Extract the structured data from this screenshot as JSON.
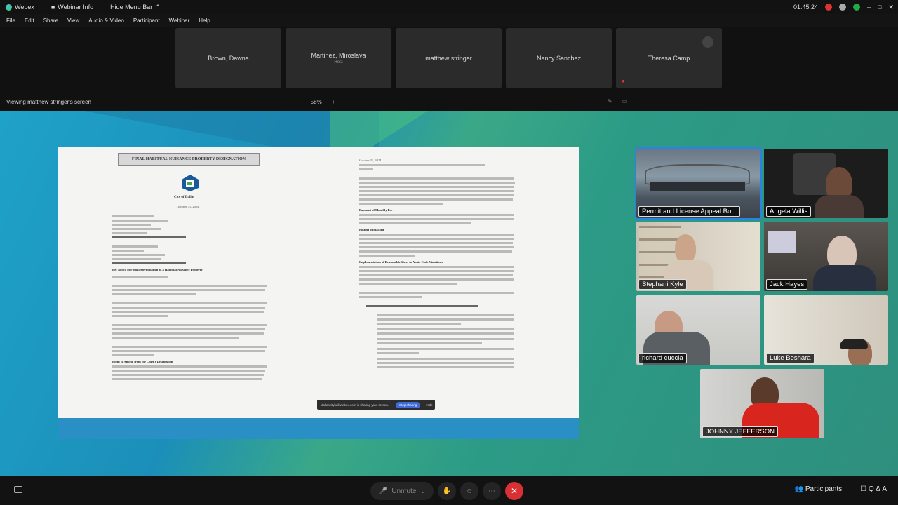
{
  "titlebar": {
    "app_name": "Webex",
    "info": "Webinar Info",
    "hide_menu": "Hide Menu Bar",
    "time": "01:45:24"
  },
  "menu": [
    "File",
    "Edit",
    "Share",
    "View",
    "Audio & Video",
    "Participant",
    "Webinar",
    "Help"
  ],
  "panelists": [
    {
      "name": "Brown, Dawna",
      "sub": ""
    },
    {
      "name": "Martinez, Miroslava",
      "sub": "Host"
    },
    {
      "name": "matthew stringer",
      "sub": ""
    },
    {
      "name": "Nancy Sanchez",
      "sub": ""
    },
    {
      "name": "Theresa Camp",
      "sub": ""
    }
  ],
  "viewing": {
    "label": "Viewing matthew stringer's screen",
    "zoom": "58%",
    "zoom_out": "−",
    "zoom_in": "+"
  },
  "document": {
    "banner": "FINAL HABITUAL NUISANCE PROPERTY DESIGNATION",
    "city": "City of Dallas",
    "date": "October 31, 2024",
    "re_line": "Re: Notice of Final Determination as a Habitual Nuisance Property",
    "right_date": "October 31, 2024",
    "heading_fee": "Payment of Monthly Fee",
    "heading_placard": "Posting of Placard",
    "heading_steps": "Implementation of Reasonable Steps to Abate Code Violations",
    "heading_appeal": "Right to Appeal from the Chief's Designation"
  },
  "sharebar": {
    "text": "dallascityhall.webex.com is sharing your screen.",
    "stop": "Stop sharing",
    "hide": "Hide"
  },
  "videos": [
    {
      "name": "Permit and License Appeal Bo..."
    },
    {
      "name": "Angela Willis"
    },
    {
      "name": "Stephani Kyle"
    },
    {
      "name": "Jack Hayes"
    },
    {
      "name": "richard cuccia"
    },
    {
      "name": "Luke Beshara"
    },
    {
      "name": "JOHNNY JEFFERSON"
    }
  ],
  "bottom": {
    "unmute": "Unmute",
    "participants": "Participants",
    "qa": "Q & A"
  },
  "colors": {
    "end_call": "#d93033",
    "active_speaker": "#2a82e4",
    "stage_gradient_start": "#1fa2c8"
  }
}
